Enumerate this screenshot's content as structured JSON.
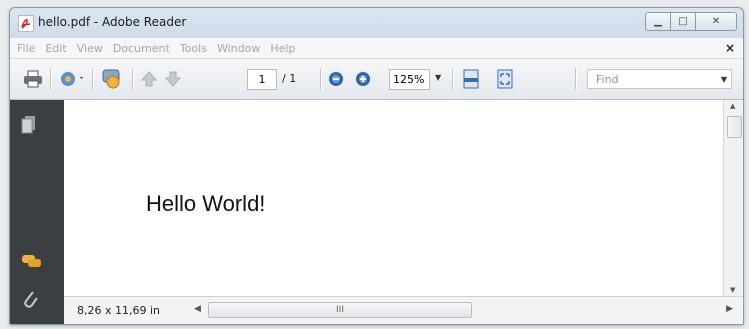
{
  "window": {
    "title": "hello.pdf - Adobe Reader"
  },
  "menubar": {
    "items": [
      "File",
      "Edit",
      "View",
      "Document",
      "Tools",
      "Window",
      "Help"
    ],
    "close": "×"
  },
  "toolbar": {
    "page_current": "1",
    "page_total": "/ 1",
    "zoom": "125%",
    "find_placeholder": "Find"
  },
  "document": {
    "text": "Hello World!"
  },
  "status": {
    "page_size": "8,26 x 11,69 in",
    "hscroll_grip": "III"
  },
  "icons": [
    "pdf-icon",
    "print-icon",
    "share-icon",
    "comment-tool-icon",
    "prev-page-icon",
    "next-page-icon",
    "zoom-out-icon",
    "zoom-in-icon",
    "fit-width-icon",
    "fit-page-icon",
    "pages-icon",
    "comments-icon",
    "attachments-icon"
  ],
  "colors": {
    "side_panel": "#3b3f42",
    "accent": "#2d66a8"
  }
}
